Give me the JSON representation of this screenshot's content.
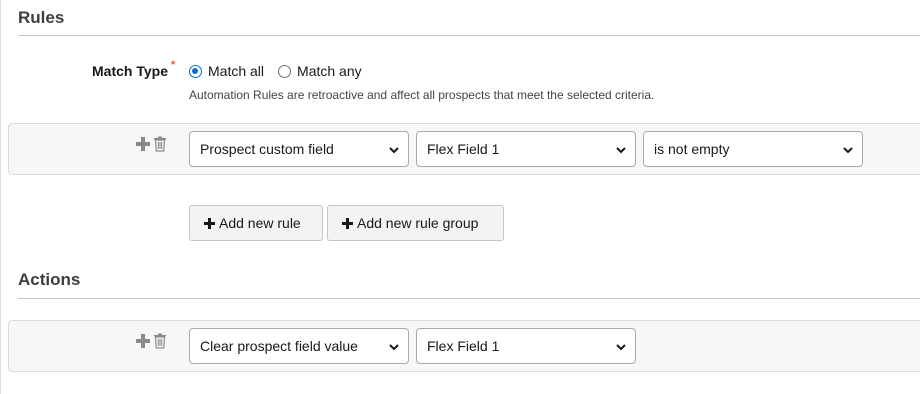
{
  "rules_section": {
    "title": "Rules",
    "match_type_label": "Match Type",
    "required_marker": "*",
    "match_options": [
      {
        "label": "Match all",
        "selected": true
      },
      {
        "label": "Match any",
        "selected": false
      }
    ],
    "help_text": "Automation Rules are retroactive and affect all prospects that meet the selected criteria.",
    "rule_row": {
      "field_type": "Prospect custom field",
      "field": "Flex Field 1",
      "operator": "is not empty"
    },
    "add_rule_label": "Add new rule",
    "add_rule_group_label": "Add new rule group"
  },
  "actions_section": {
    "title": "Actions",
    "action_row": {
      "action": "Clear prospect field value",
      "field": "Flex Field 1"
    }
  },
  "icons": [
    "plus-icon",
    "trash-icon",
    "chevron-down-icon"
  ]
}
